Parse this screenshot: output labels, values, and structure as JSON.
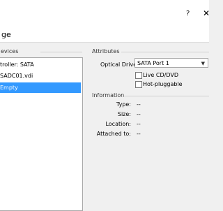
{
  "window": {
    "help_label": "?",
    "close_label": "✕"
  },
  "page": {
    "title": "ge"
  },
  "storage": {
    "group_label": "evices",
    "tree": [
      {
        "label": "troller: SATA",
        "selected": false
      },
      {
        "label": "SADC01.vdi",
        "selected": false
      },
      {
        "label": "Empty",
        "selected": true
      }
    ]
  },
  "attributes": {
    "group_label": "Attributes",
    "optical_drive_label": "Optical Drive:",
    "optical_drive_value": "SATA Port 1",
    "live_cd_label": "Live CD/DVD",
    "live_cd_checked": false,
    "hot_pluggable_label": "Hot-pluggable",
    "hot_pluggable_checked": false
  },
  "information": {
    "group_label": "Information",
    "rows": [
      {
        "key": "Type:",
        "value": "--"
      },
      {
        "key": "Size:",
        "value": "--"
      },
      {
        "key": "Location:",
        "value": "--"
      },
      {
        "key": "Attached to:",
        "value": "--"
      }
    ]
  }
}
